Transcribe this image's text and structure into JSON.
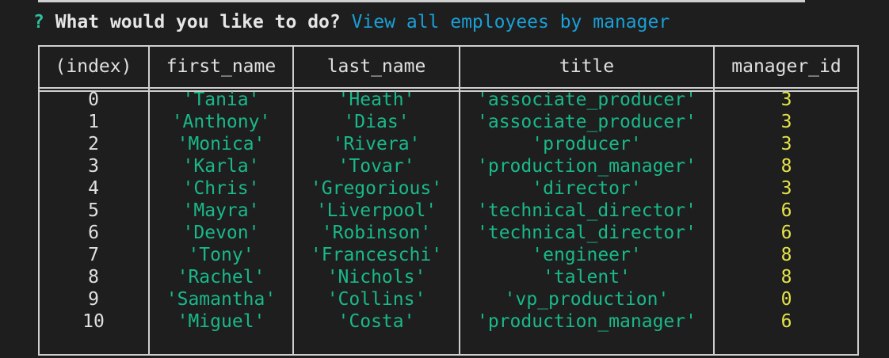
{
  "prompt": {
    "marker": "?",
    "question": "What would you like to do?",
    "answer": "View all employees by manager"
  },
  "table": {
    "columns": [
      "(index)",
      "first_name",
      "last_name",
      "title",
      "manager_id"
    ],
    "rows": [
      {
        "index": "0",
        "first_name": "'Tania'",
        "last_name": "'Heath'",
        "title": "'associate_producer'",
        "manager_id": "3"
      },
      {
        "index": "1",
        "first_name": "'Anthony'",
        "last_name": "'Dias'",
        "title": "'associate_producer'",
        "manager_id": "3"
      },
      {
        "index": "2",
        "first_name": "'Monica'",
        "last_name": "'Rivera'",
        "title": "'producer'",
        "manager_id": "3"
      },
      {
        "index": "3",
        "first_name": "'Karla'",
        "last_name": "'Tovar'",
        "title": "'production_manager'",
        "manager_id": "8"
      },
      {
        "index": "4",
        "first_name": "'Chris'",
        "last_name": "'Gregorious'",
        "title": "'director'",
        "manager_id": "3"
      },
      {
        "index": "5",
        "first_name": "'Mayra'",
        "last_name": "'Liverpool'",
        "title": "'technical_director'",
        "manager_id": "6"
      },
      {
        "index": "6",
        "first_name": "'Devon'",
        "last_name": "'Robinson'",
        "title": "'technical_director'",
        "manager_id": "6"
      },
      {
        "index": "7",
        "first_name": "'Tony'",
        "last_name": "'Franceschi'",
        "title": "'engineer'",
        "manager_id": "8"
      },
      {
        "index": "8",
        "first_name": "'Rachel'",
        "last_name": "'Nichols'",
        "title": "'talent'",
        "manager_id": "8"
      },
      {
        "index": "9",
        "first_name": "'Samantha'",
        "last_name": "'Collins'",
        "title": "'vp_production'",
        "manager_id": "0"
      },
      {
        "index": "10",
        "first_name": "'Miguel'",
        "last_name": "'Costa'",
        "title": "'production_manager'",
        "manager_id": "6"
      }
    ]
  },
  "colors": {
    "background": "#1e1e1e",
    "border": "#cfcfcf",
    "prompt_marker": "#2fbf9f",
    "answer": "#1a9fd6",
    "string_value": "#19b98a",
    "number_value": "#e3e34a"
  }
}
